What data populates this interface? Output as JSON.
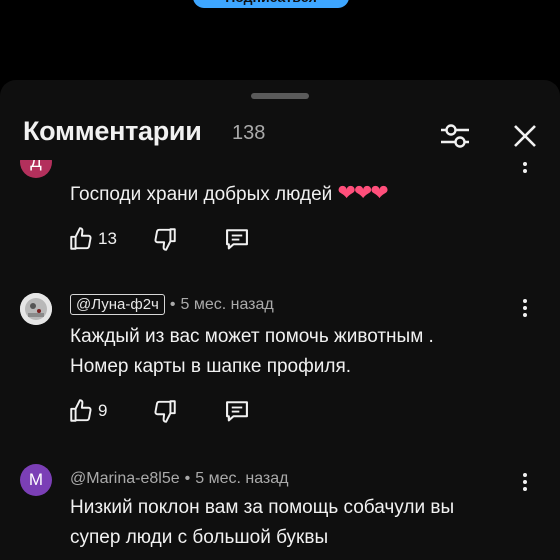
{
  "top_button": {
    "label": "Подписаться"
  },
  "sheet": {
    "title": "Комментарии",
    "count": "138",
    "filter_icon": "sliders-icon",
    "close_icon": "close-icon"
  },
  "comments": [
    {
      "avatar_letter": "Д",
      "avatar_color": "#b3305c",
      "text": "Господи храни добрых людей",
      "emoji": "❤❤❤",
      "likes": "13"
    },
    {
      "avatar_letter": "",
      "avatar_color": "#dcdcdc",
      "handle": "@Луна-ф2ч",
      "time": "5 мес. назад",
      "text_lines": [
        "Каждый из вас может помочь животным .",
        "Номер карты в шапке профиля."
      ],
      "likes": "9"
    },
    {
      "avatar_letter": "M",
      "avatar_color": "#7b3fb6",
      "handle": "@Marina-e8l5e",
      "time": "5 мес. назад",
      "text_lines": [
        "Низкий поклон вам за помощь собачули вы",
        "супер люди с большой буквы"
      ]
    }
  ],
  "colors": {
    "background": "#0f0f0f",
    "accent": "#3ea6ff",
    "secondary_text": "#aaaaaa"
  }
}
